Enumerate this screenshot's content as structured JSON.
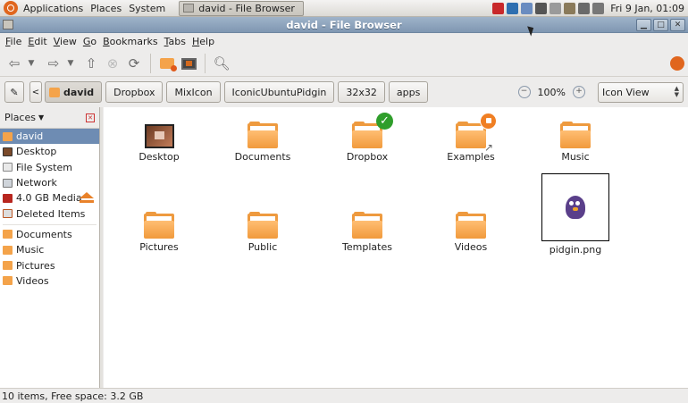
{
  "panel": {
    "menus": [
      "Applications",
      "Places",
      "System"
    ],
    "task_title": "david - File Browser",
    "clock": "Fri  9 Jan, 01:09"
  },
  "window": {
    "title": "david - File Browser"
  },
  "menubar": [
    {
      "first": "F",
      "rest": "ile"
    },
    {
      "first": "E",
      "rest": "dit"
    },
    {
      "first": "V",
      "rest": "iew"
    },
    {
      "first": "G",
      "rest": "o"
    },
    {
      "first": "B",
      "rest": "ookmarks"
    },
    {
      "first": "T",
      "rest": "abs"
    },
    {
      "first": "H",
      "rest": "elp"
    }
  ],
  "location": {
    "path": [
      "david",
      "Dropbox",
      "MixIcon",
      "IconicUbuntuPidgin",
      "32x32",
      "apps"
    ],
    "zoom": "100%",
    "view": "Icon View"
  },
  "sidebar": {
    "header": "Places",
    "items": [
      "david",
      "Desktop",
      "File System",
      "Network",
      "4.0 GB Media",
      "Deleted Items"
    ],
    "bookmarks": [
      "Documents",
      "Music",
      "Pictures",
      "Videos"
    ]
  },
  "files": [
    "Desktop",
    "Documents",
    "Dropbox",
    "Examples",
    "Music",
    "Pictures",
    "Public",
    "Templates",
    "Videos",
    "pidgin.png"
  ],
  "status": "10 items, Free space: 3.2 GB"
}
